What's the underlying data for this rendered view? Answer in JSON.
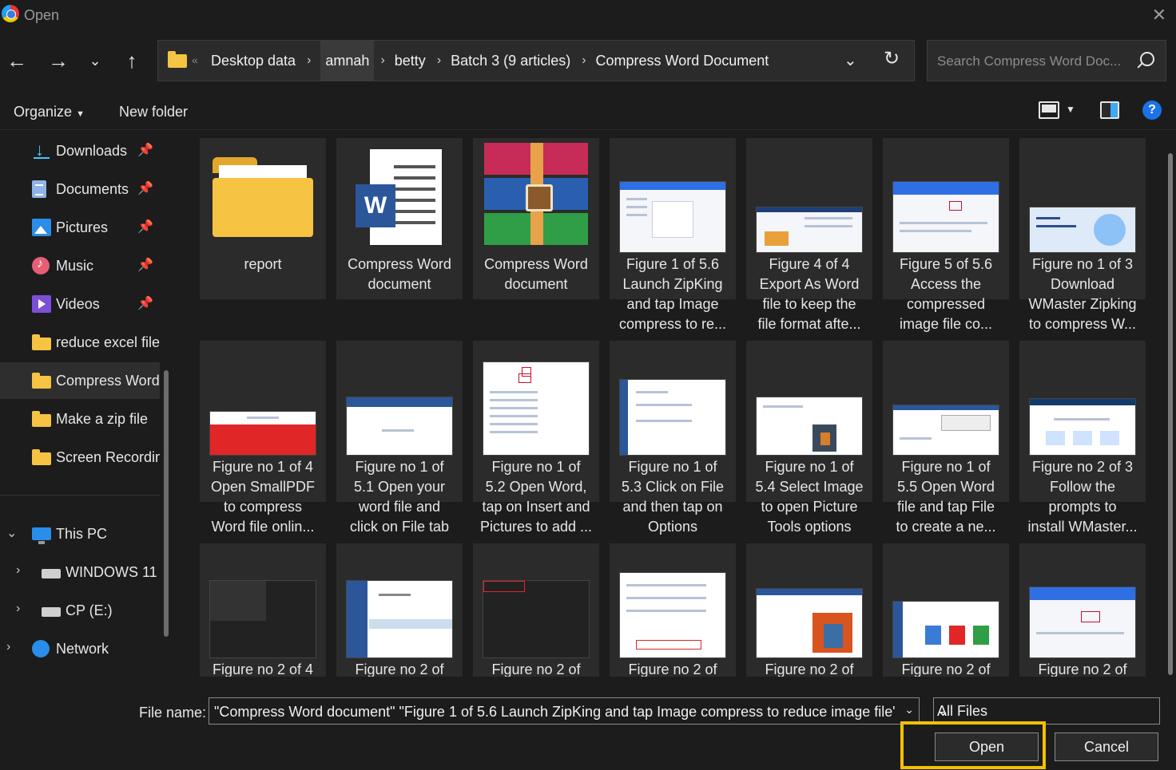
{
  "window": {
    "title": "Open"
  },
  "address": {
    "crumbs": [
      "Desktop data",
      "amnah",
      "betty",
      "Batch 3 (9 articles)",
      "Compress Word Document"
    ]
  },
  "search": {
    "placeholder": "Search Compress Word Doc..."
  },
  "toolbar": {
    "organize": "Organize",
    "new_folder": "New folder",
    "help": "?"
  },
  "sidebar": {
    "items": [
      {
        "label": "Downloads",
        "icon": "download-icon",
        "pinned": true
      },
      {
        "label": "Documents",
        "icon": "documents-icon",
        "pinned": true
      },
      {
        "label": "Pictures",
        "icon": "pictures-icon",
        "pinned": true
      },
      {
        "label": "Music",
        "icon": "music-icon",
        "pinned": true
      },
      {
        "label": "Videos",
        "icon": "videos-icon",
        "pinned": true
      },
      {
        "label": "reduce excel file",
        "icon": "folder-icon"
      },
      {
        "label": "Compress Word",
        "icon": "folder-icon",
        "selected": true
      },
      {
        "label": "Make a zip file",
        "icon": "folder-icon"
      },
      {
        "label": "Screen Recording",
        "icon": "folder-icon"
      }
    ],
    "tree": [
      {
        "label": "This PC",
        "icon": "pc-icon"
      },
      {
        "label": "WINDOWS 11",
        "icon": "drive-icon"
      },
      {
        "label": "CP (E:)",
        "icon": "drive-icon"
      },
      {
        "label": "Network",
        "icon": "network-icon"
      }
    ]
  },
  "files": [
    {
      "name": "report",
      "kind": "folder"
    },
    {
      "name": "Compress Word\ndocument",
      "kind": "word"
    },
    {
      "name": "Compress Word\ndocument",
      "kind": "rar"
    },
    {
      "name": "Figure 1 of 5.6\nLaunch ZipKing\nand tap Image\ncompress to re...",
      "kind": "shot"
    },
    {
      "name": "Figure 4 of 4\nExport As Word\nfile to keep the\nfile format afte...",
      "kind": "shot"
    },
    {
      "name": "Figure 5 of 5.6\nAccess the\ncompressed\nimage file co...",
      "kind": "shot"
    },
    {
      "name": "Figure no 1 of 3\nDownload\nWMaster Zipking\nto compress W...",
      "kind": "shot"
    },
    {
      "name": "Figure no 1 of 4\nOpen SmallPDF\nto compress\nWord file onlin...",
      "kind": "shot"
    },
    {
      "name": "Figure no 1 of\n5.1 Open your\nword file and\nclick on File tab",
      "kind": "shot"
    },
    {
      "name": "Figure no 1 of\n5.2 Open Word,\ntap on Insert and\nPictures to add ...",
      "kind": "shot"
    },
    {
      "name": "Figure no 1 of\n5.3 Click on File\nand then tap on\nOptions",
      "kind": "shot"
    },
    {
      "name": "Figure no 1 of\n5.4 Select Image\nto open Picture\nTools options",
      "kind": "shot"
    },
    {
      "name": "Figure no 1 of\n5.5 Open Word\nfile and tap File\nto create a ne...",
      "kind": "shot"
    },
    {
      "name": "Figure no 2 of 3\nFollow the\nprompts to\ninstall WMaster...",
      "kind": "shot"
    },
    {
      "name": "Figure no 2 of 4",
      "kind": "shot"
    },
    {
      "name": "Figure no 2 of",
      "kind": "shot"
    },
    {
      "name": "Figure no 2 of",
      "kind": "shot"
    },
    {
      "name": "Figure no 2 of",
      "kind": "shot"
    },
    {
      "name": "Figure no 2 of",
      "kind": "shot"
    },
    {
      "name": "Figure no 2 of",
      "kind": "shot"
    },
    {
      "name": "Figure no 2 of",
      "kind": "shot"
    }
  ],
  "footer": {
    "file_name_label": "File name:",
    "file_name_value": "\"Compress Word document\" \"Figure 1 of 5.6 Launch ZipKing and tap Image compress to reduce image file\"",
    "file_type": "All Files",
    "open": "Open",
    "cancel": "Cancel"
  },
  "colors": {
    "accent": "#1a73e8",
    "highlight": "#f2c000",
    "folder": "#f6c343"
  }
}
